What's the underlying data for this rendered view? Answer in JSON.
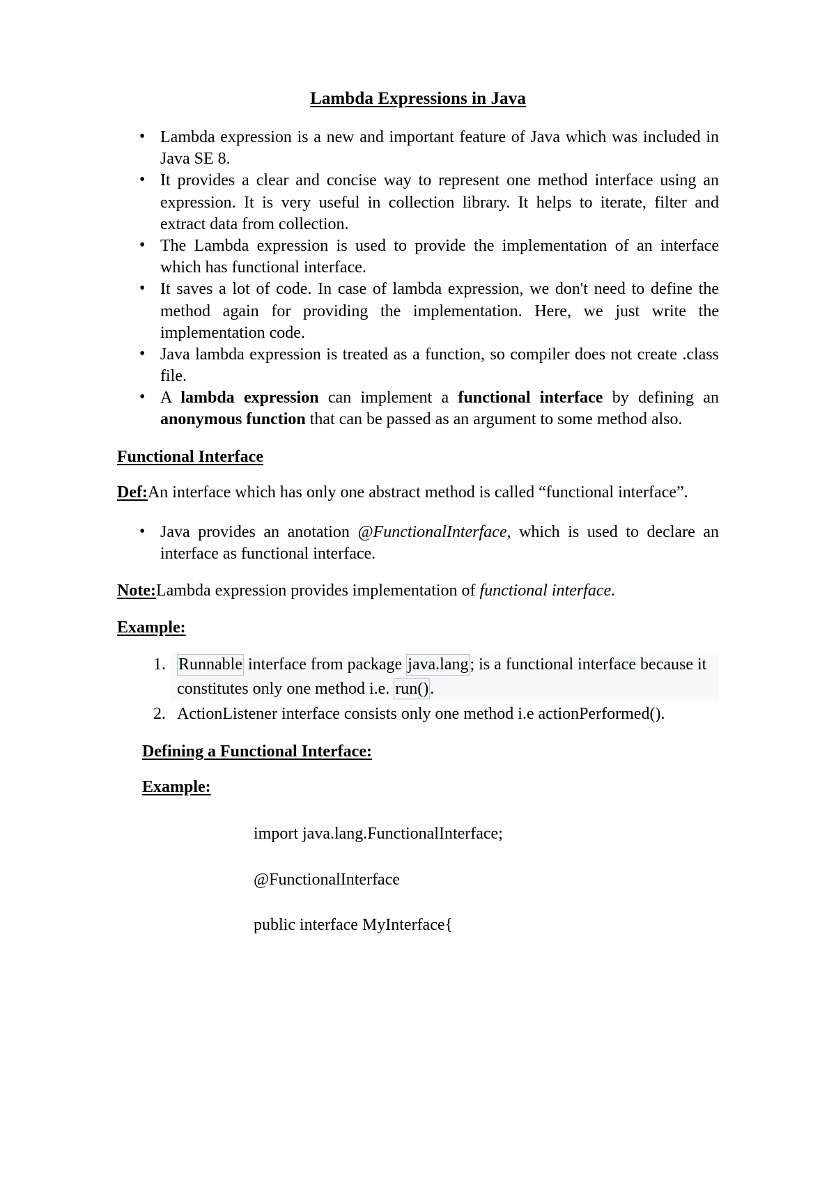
{
  "document": {
    "title": "Lambda Expressions in Java",
    "intro_bullets": [
      {
        "segments": [
          {
            "text": "Lambda expression is a new and important feature of Java which was included in Java SE 8.",
            "style": "normal"
          }
        ]
      },
      {
        "segments": [
          {
            "text": "It provides a clear and concise way to represent one method interface using an expression. It is very useful in collection library. It helps to iterate, filter and extract data from collection.",
            "style": "normal"
          }
        ]
      },
      {
        "segments": [
          {
            "text": "The Lambda expression is used to provide the implementation of an interface which has functional interface.",
            "style": "normal"
          }
        ]
      },
      {
        "segments": [
          {
            "text": "It saves a lot of code. In case of lambda expression, we don't need to define the method again for providing the implementation. Here, we just write the implementation code.",
            "style": "normal"
          }
        ]
      },
      {
        "segments": [
          {
            "text": "Java lambda expression is treated as a function, so compiler does not create .class file.",
            "style": "normal"
          }
        ]
      },
      {
        "segments": [
          {
            "text": "A ",
            "style": "normal"
          },
          {
            "text": "lambda expression",
            "style": "bold"
          },
          {
            "text": " can implement a ",
            "style": "normal"
          },
          {
            "text": "functional interface",
            "style": "bold"
          },
          {
            "text": " by defining an ",
            "style": "normal"
          },
          {
            "text": "anonymous function",
            "style": "bold"
          },
          {
            "text": " that can be passed as an argument to some method also.",
            "style": "normal"
          }
        ]
      }
    ],
    "section_functional_interface": {
      "heading": "Functional Interface",
      "definition": {
        "label": "Def:",
        "text": "An interface which has only one abstract method is called “functional interface”."
      },
      "annotation_bullet": {
        "segments": [
          {
            "text": "Java provides an anotation ",
            "style": "normal"
          },
          {
            "text": "@FunctionalInterface",
            "style": "italic"
          },
          {
            "text": ", which is used to declare an interface as functional interface.",
            "style": "normal"
          }
        ]
      },
      "note": {
        "label": "Note:",
        "segments": [
          {
            "text": "Lambda expression provides implementation of ",
            "style": "normal"
          },
          {
            "text": "functional interface",
            "style": "italic"
          },
          {
            "text": ".",
            "style": "normal"
          }
        ]
      }
    },
    "section_example": {
      "heading": "Example:",
      "items": [
        {
          "segments": [
            {
              "text": "Runnable",
              "style": "field"
            },
            {
              "text": " interface from package ",
              "style": "normal"
            },
            {
              "text": "java.lang",
              "style": "field"
            },
            {
              "text": "; is a functional interface because it constitutes only one method i.e. ",
              "style": "normal"
            },
            {
              "text": "run()",
              "style": "field"
            },
            {
              "text": ".",
              "style": "normal"
            }
          ],
          "highlighted": true
        },
        {
          "segments": [
            {
              "text": "ActionListener interface consists only one method i.e actionPerformed().",
              "style": "normal"
            }
          ],
          "highlighted": false
        }
      ]
    },
    "section_defining": {
      "heading": "Defining a Functional Interface:",
      "example_heading": "Example:",
      "code_lines": [
        "import java.lang.FunctionalInterface;",
        "@FunctionalInterface",
        "public interface MyInterface{"
      ]
    }
  },
  "colors": {
    "page_background": "#ffffff",
    "text": "#000000",
    "field_border": "#b6c2d8",
    "field_background": "#f6f8fc",
    "highlight_background": "#f8f9fb"
  }
}
